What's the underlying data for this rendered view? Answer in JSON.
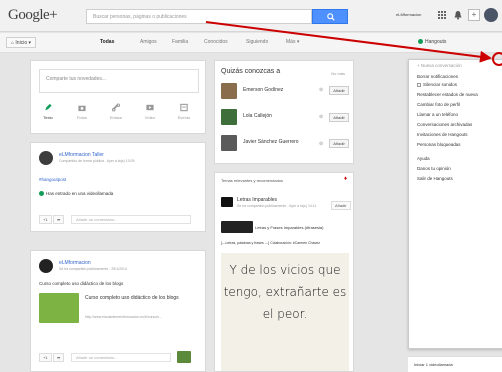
{
  "topbar": {
    "logo": "Google+",
    "search_placeholder": "Buscar personas, páginas o publicaciones",
    "user_email": "eLMformacion"
  },
  "subbar": {
    "home_label": "Inicio",
    "tabs": [
      "Todas",
      "Amigos",
      "Familia",
      "Conocidos",
      "Siguiendo",
      "Más"
    ],
    "hangouts_label": "Hangouts"
  },
  "share": {
    "placeholder": "Comparte tus novedades...",
    "tools": [
      "Texto",
      "Fotos",
      "Enlace",
      "Vídeo",
      "Evento"
    ]
  },
  "post1": {
    "author": "eLMformacion Taller",
    "meta": "Compartido de forma pública - Ayer a la(s) 13:05",
    "hashtag": "#hangoutpost",
    "text": "Has entrado en una videollamada",
    "plus": "+1",
    "comment_placeholder": "Añadir un comentario..."
  },
  "post2": {
    "author": "eLMformacion",
    "meta": "Se ha compartido públicamente - 29/1/2014",
    "text": "Curso completo uso didáctico de los blogs",
    "link_title": "Curso completo uso didáctico de los blogs",
    "link_url": "http://www.elaulademelmformacion.es/#!curso/c...",
    "plus": "+1",
    "comment_placeholder": "Añadir un comentario..."
  },
  "suggestions": {
    "title": "Quizás conozcas a",
    "close": "No más",
    "people": [
      {
        "name": "Emerson Godínez",
        "add": "Añadir"
      },
      {
        "name": "Lola Callejón",
        "add": "Añadir"
      },
      {
        "name": "Javier Sánchez Guerrero",
        "add": "Añadir"
      }
    ]
  },
  "topics": {
    "title": "Temas relevantes y recomendados",
    "item1_title": "Letras Imparables",
    "item1_meta": "Se ha compartido públicamente - Ayer a la(s) 14:11",
    "item1_btn": "Añadir",
    "item2_title": "Letras y Frases Imparables (#frasesla)",
    "item2_text": "[---Letras, palabras y frases ---] Colaboración: #Carmen Chávez",
    "quote": "Y de los vicios que tengo, extrañarte es el peor."
  },
  "menu": {
    "header": "Nueva conversación",
    "items": [
      "Borrar notificaciones",
      "Silenciar sonidos",
      "Restablecer estados de nueva",
      "Cambiar foto de perfil",
      "Llamar a un teléfono",
      "Conversaciones archivadas",
      "Invitaciones de Hangouts",
      "Personas bloqueadas",
      "Ayuda",
      "Danos tu opinión",
      "Salir de Hangouts"
    ]
  },
  "bottom_chat": "Iniciar 1 videollamada",
  "colors": {
    "accent": "#4d90fe",
    "link": "#3366cc",
    "annotation": "#cc0000",
    "hangouts_green": "#0f9d58"
  }
}
